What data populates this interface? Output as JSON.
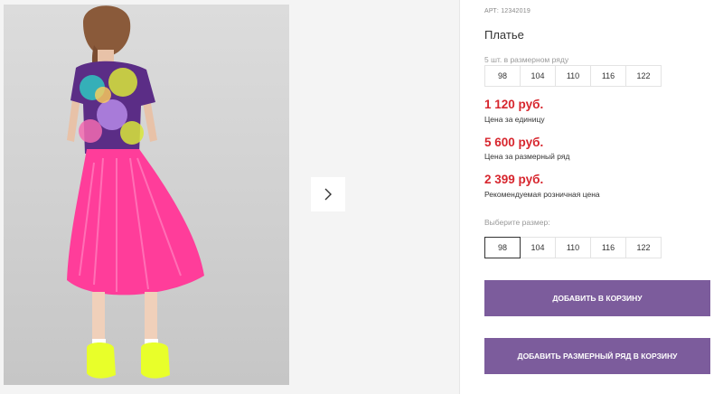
{
  "product": {
    "sku": "АРТ: 12342019",
    "title": "Платье",
    "set_caption": "5 шт. в размерном ряду",
    "sizes_set": [
      "98",
      "104",
      "110",
      "116",
      "122"
    ],
    "prices": [
      {
        "value": "1 120 руб.",
        "caption": "Цена за единицу"
      },
      {
        "value": "5 600 руб.",
        "caption": "Цена за размерный ряд"
      },
      {
        "value": "2 399 руб.",
        "caption": "Рекомендуемая розничная цена"
      }
    ],
    "choose_label": "Выберите размер:",
    "sizes_choose": [
      "98",
      "104",
      "110",
      "116",
      "122"
    ],
    "selected_size": "98",
    "add_to_cart": "ДОБАВИТЬ В КОРЗИНУ",
    "add_set_to_cart": "ДОБАВИТЬ РАЗМЕРНЫЙ РЯД В КОРЗИНУ"
  },
  "gallery": {
    "next_icon": "chevron-right-icon"
  },
  "colors": {
    "price": "#d7262e",
    "button": "#7c5c9c",
    "dress_skirt": "#ff3d9a",
    "shoes": "#e8ff2a"
  }
}
